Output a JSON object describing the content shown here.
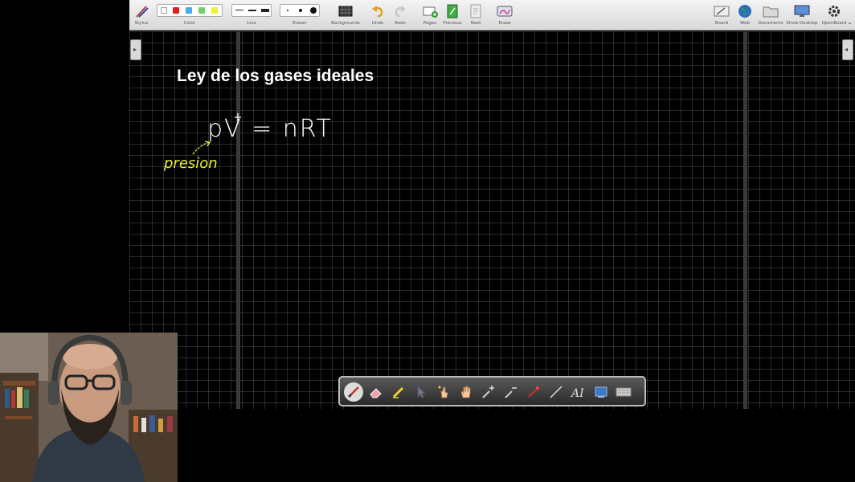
{
  "toolbar": {
    "stylus_label": "Stylus",
    "color_label": "Color",
    "line_label": "Line",
    "eraser_label": "Eraser",
    "backgrounds_label": "Backgrounds",
    "undo_label": "Undo",
    "redo_label": "Redo",
    "pages_label": "Pages",
    "previous_label": "Previous",
    "next_label": "Next",
    "erase_label": "Erase",
    "board_label": "Board",
    "web_label": "Web",
    "documents_label": "Documents",
    "show_desktop_label": "Show Desktop",
    "openboard_label": "OpenBoard",
    "colors": [
      "#ffffff",
      "#e02020",
      "#49a8f0",
      "#6ed36e",
      "#f0ef3a"
    ]
  },
  "board": {
    "title": "Ley de los gases ideales",
    "formula": "pV = nRT",
    "annotation": "presion",
    "background_color": "#000000",
    "ink_color": "#ffffff",
    "annotation_color": "#e8ef3a"
  },
  "float_toolbar": {
    "tools": [
      "pen-icon",
      "eraser-icon",
      "highlighter-icon",
      "selector-icon",
      "interact-icon",
      "hand-icon",
      "zoom-in-icon",
      "zoom-out-icon",
      "laser-icon",
      "line-icon",
      "text-icon",
      "capture-icon",
      "keyboard-icon"
    ]
  }
}
